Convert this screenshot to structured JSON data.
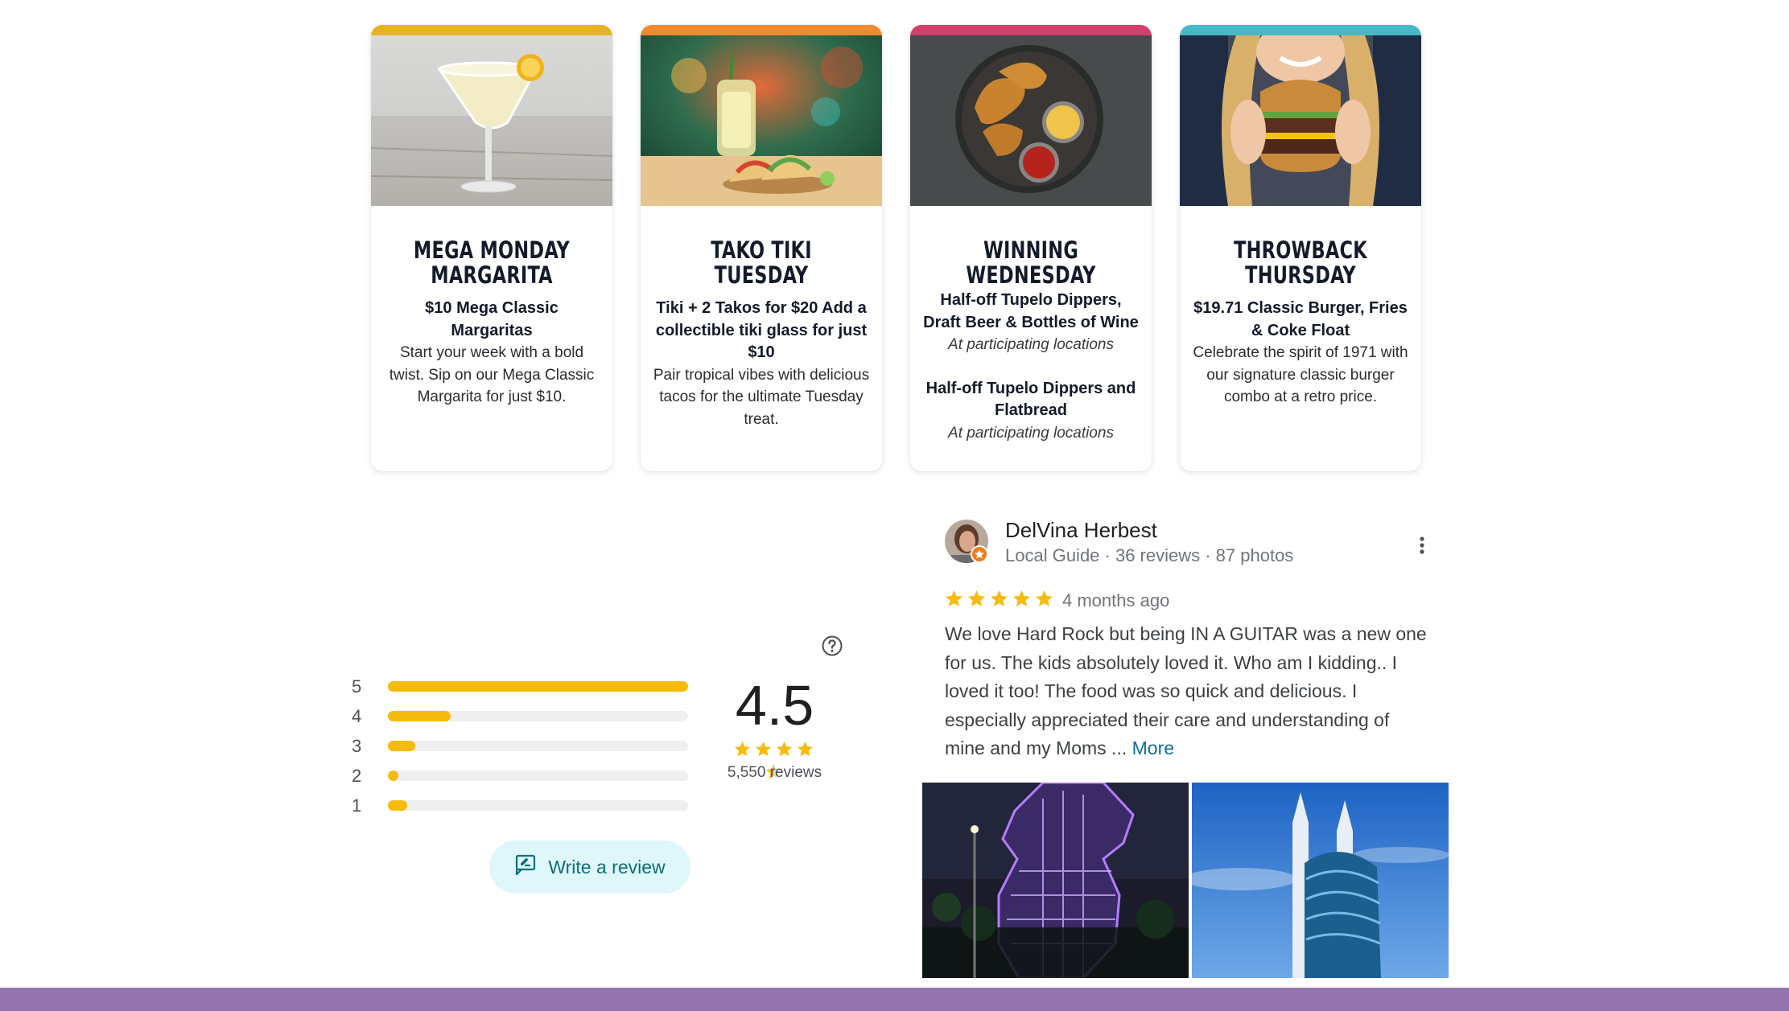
{
  "cards": [
    {
      "stripe_color": "#e6b422",
      "title": "MEGA MONDAY MARGARITA",
      "deal": "$10 Mega Classic Margaritas",
      "desc": "Start your week with a bold twist. Sip on our Mega Classic Margarita for just $10."
    },
    {
      "stripe_color": "#f28a30",
      "title": "TAKO TIKI TUESDAY",
      "deal": "Tiki + 2 Takos for $20 Add a collectible tiki glass for just $10",
      "desc": "Pair tropical vibes with delicious tacos for the ultimate Tuesday treat."
    },
    {
      "stripe_color": "#d43f6d",
      "title": "WINNING WEDNESDAY",
      "deal": "Half-off Tupelo Dippers, Draft Beer & Bottles of Wine",
      "note": "At participating locations",
      "deal2": "Half-off Tupelo Dippers and Flatbread",
      "note2": "At participating locations"
    },
    {
      "stripe_color": "#46b9c6",
      "title": "THROWBACK THURSDAY",
      "deal": "$19.71 Classic Burger, Fries & Coke Float",
      "desc": "Celebrate the spirit of 1971 with our signature classic burger combo at a retro price."
    }
  ],
  "ratings": {
    "distribution": [
      {
        "stars": "5",
        "fraction": 1.0
      },
      {
        "stars": "4",
        "fraction": 0.21
      },
      {
        "stars": "3",
        "fraction": 0.09
      },
      {
        "stars": "2",
        "fraction": 0.035
      },
      {
        "stars": "1",
        "fraction": 0.065
      }
    ],
    "average": "4.5",
    "star_value": 4.5,
    "count_label": "5,550 reviews",
    "write_review_label": "Write a review",
    "bar_color": "#f7bb0e",
    "icons": {
      "help": "help-circle-icon",
      "write": "rate-review-icon"
    }
  },
  "review": {
    "author": "DelVina Herbest",
    "meta": "Local Guide · 36 reviews · 87 photos",
    "stars": 5,
    "time": "4 months ago",
    "text": "We love Hard Rock but being IN A GUITAR was a new one for us. The kids absolutely loved it. Who am I kidding.. I loved it too! The food was so quick and delicious. I especially appreciated their care and understanding of mine and my Moms ... ",
    "more_label": "More"
  },
  "colors": {
    "footer": "#9474ad",
    "accent": "#0b6e78",
    "star": "#f7bb0e"
  }
}
